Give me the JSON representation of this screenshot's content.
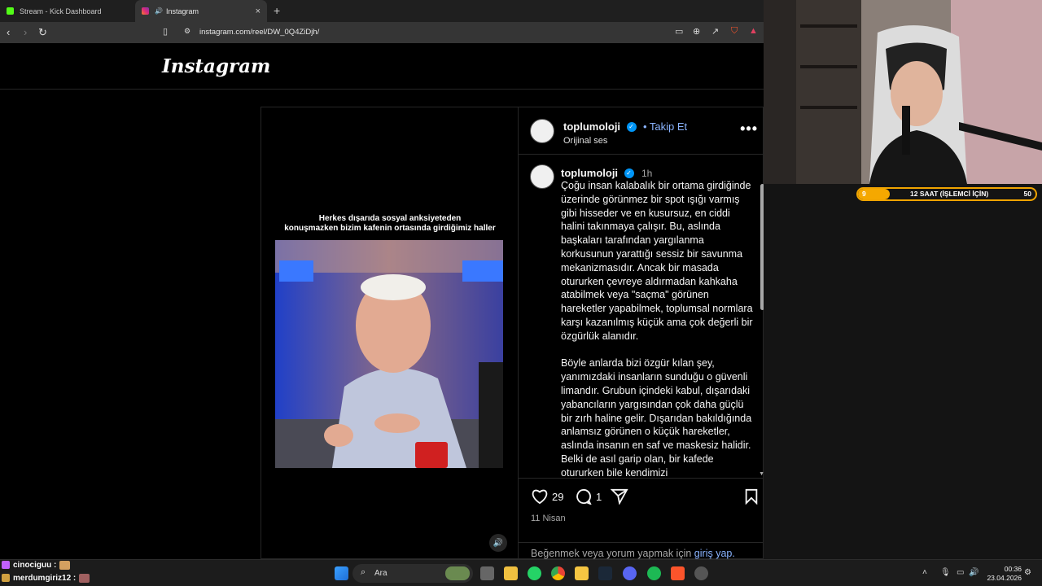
{
  "browser": {
    "tabs": [
      {
        "title": "Stream - Kick Dashboard",
        "favicon_color": "#53fc18"
      },
      {
        "title": "Instagram",
        "favicon_color": "#e1306c"
      }
    ],
    "new_tab": "+",
    "close": "×",
    "url": "instagram.com/reel/DW_0Q4ZiDjh/"
  },
  "instagram": {
    "logo": "Instagram",
    "reel": {
      "caption_line1": "Herkes dışarıda sosyal anksiyeteden",
      "caption_line2": "konuşmazken bizim kafenin ortasında girdiğimiz haller"
    },
    "post": {
      "username": "toplumoloji",
      "follow_label": "• Takip Et",
      "audio": "Orijinal ses",
      "time_ago": "1h",
      "caption_p1": "Çoğu insan kalabalık bir ortama girdiğinde üzerinde görünmez bir spot ışığı varmış gibi hisseder ve en kusursuz, en ciddi halini takınmaya çalışır. Bu, aslında başkaları tarafından yargılanma korkusunun yarattığı sessiz bir savunma mekanizmasıdır. Ancak bir masada otururken çevreye aldırmadan kahkaha atabilmek veya \"saçma\" görünen hareketler yapabilmek, toplumsal normlara karşı kazanılmış küçük ama çok değerli bir özgürlük alanıdır.",
      "caption_p2": "Böyle anlarda bizi özgür kılan şey, yanımızdaki insanların sunduğu o güvenli limandır. Grubun içindeki kabul, dışarıdaki yabancıların yargısından çok daha güçlü bir zırh haline gelir. Dışarıdan bakıldığında anlamsız görünen o küçük hareketler, aslında insanın en saf ve maskesiz halidir. Belki de asıl garip olan, bir kafede otururken bile kendimizi",
      "likes": "29",
      "comments": "1",
      "date": "11 Nisan",
      "login_prompt": "Beğenmek veya yorum yapmak için",
      "login_link": "giriş yap."
    }
  },
  "stream_overlay": {
    "progress_left": "9",
    "progress_label": "12 SAAT (İŞLEMCİ İÇİN)",
    "progress_right": "50",
    "progress_fraction": 0.18
  },
  "chat": [
    {
      "user": "cinociguu :",
      "badge_color": "#c060ff"
    },
    {
      "user": "merdumgiriz12 :",
      "badge_color": "#d0a040"
    }
  ],
  "taskbar": {
    "search_placeholder": "Ara",
    "time": "00:36",
    "date": "23.04.2026"
  }
}
